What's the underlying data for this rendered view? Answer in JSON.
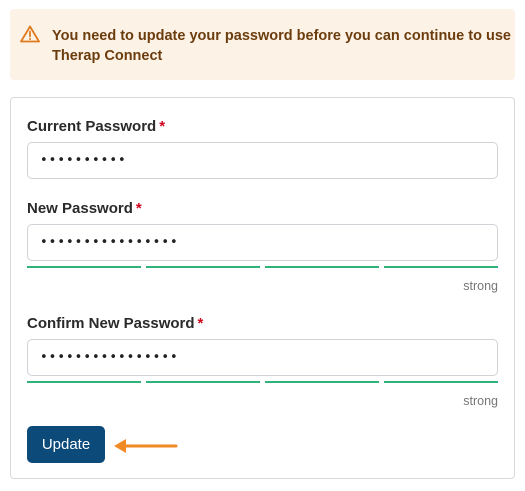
{
  "alert": {
    "icon": "warning-triangle-icon",
    "message": "You need to update your password before you can continue to use Therap Connect",
    "color": "#e07a1f"
  },
  "form": {
    "current_password": {
      "label": "Current Password",
      "required_mark": "*",
      "value": "••••••••••"
    },
    "new_password": {
      "label": "New Password",
      "required_mark": "*",
      "value": "••••••••••••••••",
      "strength": "strong"
    },
    "confirm_password": {
      "label": "Confirm New Password",
      "required_mark": "*",
      "value": "••••••••••••••••",
      "strength": "strong"
    },
    "submit_label": "Update"
  },
  "annotation": {
    "icon": "arrow-left-icon",
    "color": "#f08a24"
  }
}
